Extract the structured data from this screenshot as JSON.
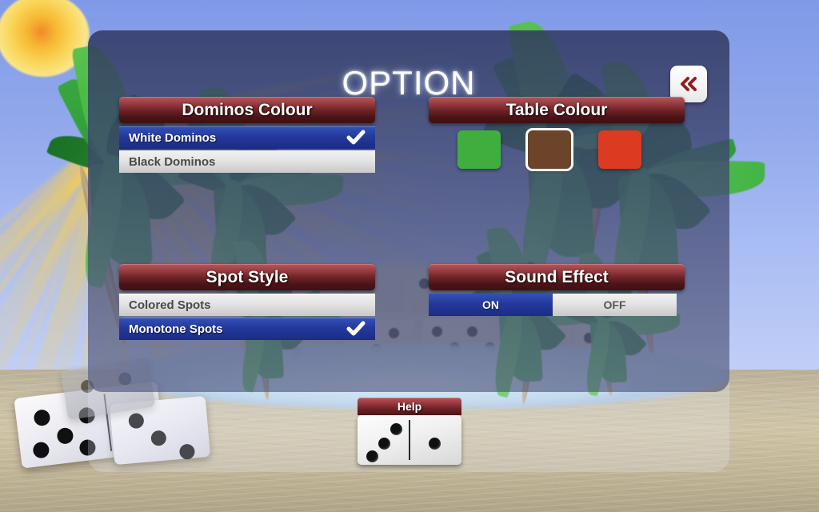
{
  "header": {
    "title": "OPTION",
    "back_button_icon": "double-chevron-left-icon"
  },
  "groups": {
    "dominos_colour": {
      "label": "Dominos Colour",
      "options": [
        {
          "label": "White Dominos",
          "selected": true
        },
        {
          "label": "Black Dominos",
          "selected": false
        }
      ]
    },
    "table_colour": {
      "label": "Table Colour",
      "swatches": [
        {
          "name": "green",
          "color": "#3fae3f",
          "selected": false
        },
        {
          "name": "brown",
          "color": "#6b4429",
          "selected": true
        },
        {
          "name": "red",
          "color": "#dd3a22",
          "selected": false
        }
      ]
    },
    "spot_style": {
      "label": "Spot Style",
      "options": [
        {
          "label": "Colored Spots",
          "selected": false
        },
        {
          "label": "Monotone Spots",
          "selected": true
        }
      ]
    },
    "sound_effect": {
      "label": "Sound Effect",
      "on_label": "ON",
      "off_label": "OFF",
      "value": "ON"
    }
  },
  "help": {
    "label": "Help",
    "domino_left_pips": 3,
    "domino_right_pips": 1
  },
  "theme": {
    "header_red_light": "#b4585d",
    "header_red_dark": "#3f1013",
    "selected_blue": "#24399c",
    "unselected_grey": "#e4e4e4",
    "title_white": "#ffffff"
  },
  "scene": {
    "sun": "sun-icon",
    "background": "beach-sunset-dominos"
  }
}
